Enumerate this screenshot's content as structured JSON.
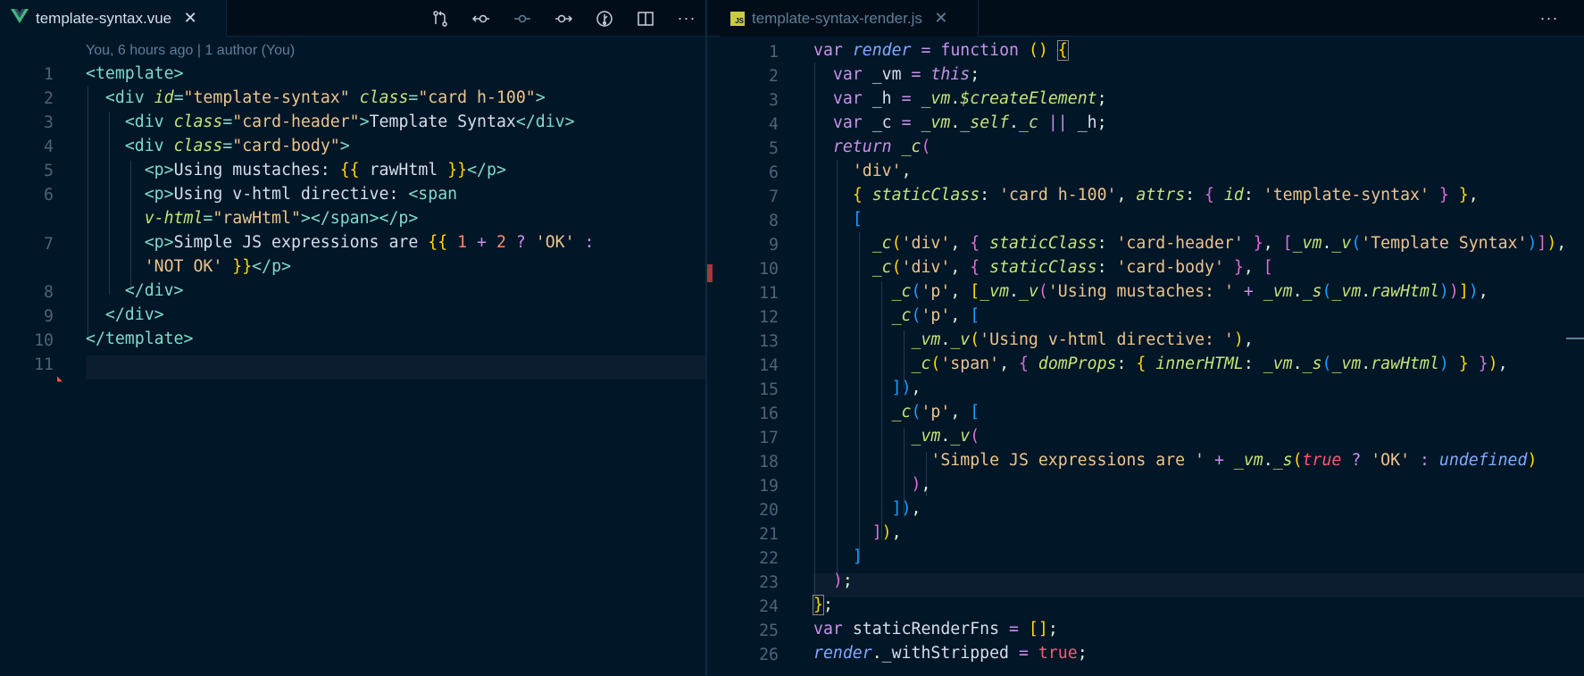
{
  "left": {
    "tab": {
      "label": "template-syntax.vue",
      "icon": "vue-icon"
    },
    "toolbar": [
      {
        "name": "open-changes-icon"
      },
      {
        "name": "previous-change-icon"
      },
      {
        "name": "commit-icon"
      },
      {
        "name": "next-change-icon"
      },
      {
        "name": "git-blame-icon"
      },
      {
        "name": "split-editor-icon"
      },
      {
        "name": "more-actions-icon",
        "glyph": "···"
      }
    ],
    "blame": "You, 6 hours ago | 1 author (You)",
    "line_numbers": [
      "1",
      "2",
      "3",
      "4",
      "5",
      "6",
      "",
      "7",
      "",
      "8",
      "9",
      "10",
      "11"
    ]
  },
  "right": {
    "tab": {
      "label": "template-syntax-render.js",
      "icon": "js-icon",
      "icon_text": "JS"
    },
    "more_glyph": "···",
    "line_numbers": [
      "1",
      "2",
      "3",
      "4",
      "5",
      "6",
      "7",
      "8",
      "9",
      "10",
      "11",
      "12",
      "13",
      "14",
      "15",
      "16",
      "17",
      "18",
      "19",
      "20",
      "21",
      "22",
      "23",
      "24",
      "25",
      "26"
    ]
  },
  "colors": {
    "background": "#011627",
    "tag": "#7fdbca",
    "attribute": "#c5e478",
    "string": "#ecc48d",
    "keyword": "#c792ea",
    "function": "#82aaff"
  }
}
